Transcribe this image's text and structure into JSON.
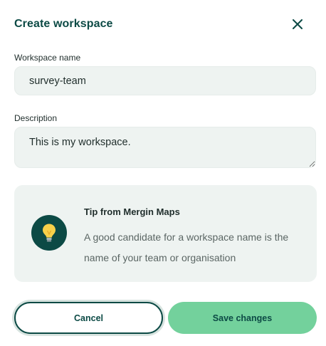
{
  "dialog": {
    "title": "Create workspace",
    "close_icon": "close-icon"
  },
  "form": {
    "name_label": "Workspace name",
    "name_value": "survey-team",
    "description_label": "Description",
    "description_value": "This is my workspace."
  },
  "tip": {
    "icon": "lightbulb-icon",
    "title": "Tip from Mergin Maps",
    "text": "A good candidate for a workspace name is the name of your team or organisation"
  },
  "actions": {
    "cancel_label": "Cancel",
    "save_label": "Save changes"
  },
  "colors": {
    "primary_dark": "#0c4a45",
    "accent_green": "#73d19c",
    "surface": "#eef3f1",
    "bulb_yellow": "#f8d14a"
  }
}
